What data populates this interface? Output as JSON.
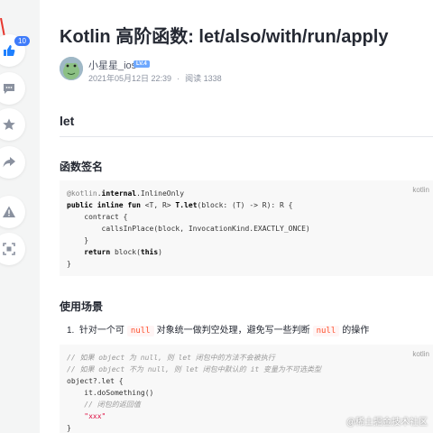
{
  "rail": {
    "like_count": "10",
    "icons": [
      "thumbs-up-icon",
      "comment-icon",
      "star-icon",
      "share-icon",
      "report-icon",
      "fullscreen-icon"
    ]
  },
  "article": {
    "title": "Kotlin 高阶函数: let/also/with/run/apply",
    "author": "小星星_ios",
    "level": "LV.4",
    "date": "2021年05月12日 22:39",
    "reads": "阅读 1338",
    "h2_let": "let",
    "h3_signature": "函数签名",
    "h3_usage": "使用场景",
    "list_item": {
      "number": "1.",
      "text_before": "针对一个可",
      "code1": "null",
      "text_middle": "对象统一做判空处理，避免写一些判断",
      "code2": "null",
      "text_after": "的操作"
    }
  },
  "code1": {
    "lang": "kotlin",
    "lines": {
      "l1_ann": "@kotlin",
      "l1_dot": ".",
      "l1_internal": "internal",
      "l1_rest": ".InlineOnly",
      "l2_kw": "public inline fun",
      "l2_gen": " <T, R> ",
      "l2_name": "T.let",
      "l2_rest": "(block: (T) -> R): R {",
      "l3": "    contract {",
      "l4": "        callsInPlace(block, InvocationKind.EXACTLY_ONCE)",
      "l5": "    }",
      "l6_kw": "    return",
      "l6_rest": " block(",
      "l6_this": "this",
      "l6_end": ")",
      "l7": "}"
    }
  },
  "code2": {
    "lang": "kotlin",
    "lines": {
      "c1": "// 如果 object 为 null, 则 let 闭包中的方法不会被执行",
      "c2": "// 如果 object 不为 null, 则 let 闭包中默认的 it 变量为不可选类型",
      "l3": "object?.let {",
      "l4": "    it.doSomething()",
      "c5": "    // 闭包的返回值",
      "s6": "    \"xxx\"",
      "l7": "}"
    }
  },
  "watermark": "@稀土掘金技术社区",
  "colors": {
    "accent": "#1e80ff",
    "badge": "#3e7bfa",
    "inline_code": "#ff502c",
    "arrow": "#e8382f"
  }
}
